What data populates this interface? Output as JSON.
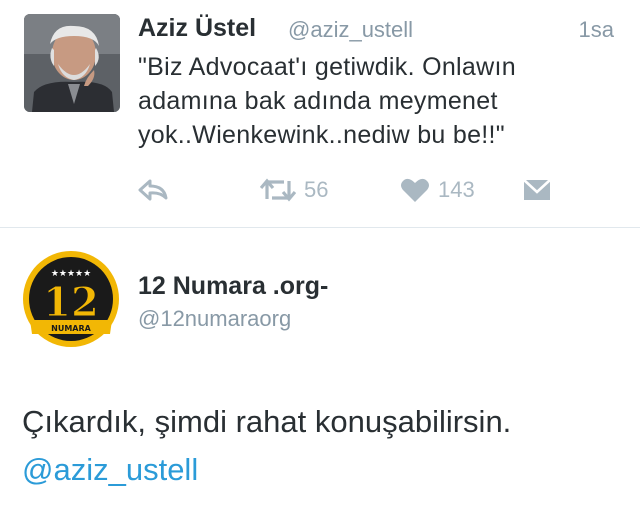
{
  "tweet": {
    "author_name": "Aziz Üstel",
    "author_handle": "@aziz_ustell",
    "time": "1sa",
    "text_lines": [
      "\"Biz Advocaat'ı getiwdik. Onlawın",
      "adamına bak adında meymenet",
      "yok..Wienkewink..nediw bu be!!\""
    ],
    "retweet_count": "56",
    "like_count": "143",
    "icons": [
      "reply-icon",
      "retweet-icon",
      "heart-icon",
      "direct-message-icon"
    ]
  },
  "reply": {
    "author_name": "12 Numara .org-",
    "author_handle": "@12numaraorg",
    "logo_number": "12",
    "logo_banner": "NUMARA",
    "logo_stars": "★★★★★",
    "text": "Çıkardık, şimdi rahat konuşabilirsin.",
    "mention": "@aziz_ustell"
  },
  "colors": {
    "text": "#292f33",
    "secondary": "#8899a6",
    "action_gray": "#aab8c2",
    "link": "#2b9bd8",
    "logo_gold": "#f2b705",
    "logo_dark": "#1a1a1a"
  }
}
